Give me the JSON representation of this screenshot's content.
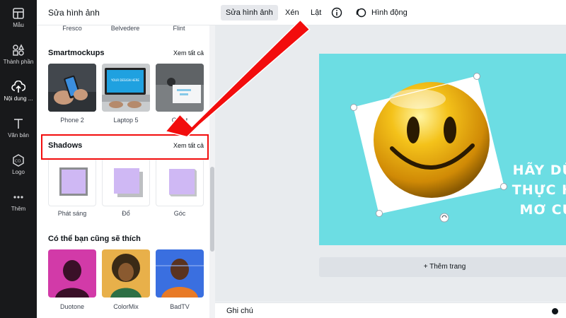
{
  "colors": {
    "accent_red": "#f20d0d",
    "page_background": "#6cdde3",
    "rail_background": "#18191b"
  },
  "rail": {
    "items": [
      {
        "label": "Mẫu",
        "icon": "template-icon"
      },
      {
        "label": "Thành phần",
        "icon": "elements-icon"
      },
      {
        "label": "Nội dung ...",
        "icon": "upload-icon",
        "active": true
      },
      {
        "label": "Văn bản",
        "icon": "text-icon"
      },
      {
        "label": "Logo",
        "icon": "logo-icon"
      },
      {
        "label": "Thêm",
        "icon": "more-icon"
      }
    ]
  },
  "panel": {
    "title": "Sửa hình ảnh",
    "top_labels": [
      "Fresco",
      "Belvedere",
      "Flint"
    ],
    "smartmockups": {
      "title": "Smartmockups",
      "see_all": "Xem tất cả",
      "items": [
        "Phone 2",
        "Laptop 5",
        "Greet"
      ],
      "laptop_screen_text": "YOUR DESIGN HERE"
    },
    "shadows": {
      "title": "Shadows",
      "see_all": "Xem tất cả",
      "items": [
        "Phát sáng",
        "Đổ",
        "Góc"
      ]
    },
    "suggested": {
      "title": "Có thể bạn cũng sẽ thích",
      "items": [
        "Duotone",
        "ColorMix",
        "BadTV"
      ]
    }
  },
  "toolbar": {
    "edit_image": "Sửa hình ảnh",
    "crop": "Xén",
    "flip": "Lật",
    "animate": "Hình động"
  },
  "canvas": {
    "text_lines": [
      "HÃY DŨ",
      "THỰC H",
      "MƠ CỦ"
    ],
    "add_page": "+ Thêm trang"
  },
  "footer": {
    "notes": "Ghi chú"
  }
}
